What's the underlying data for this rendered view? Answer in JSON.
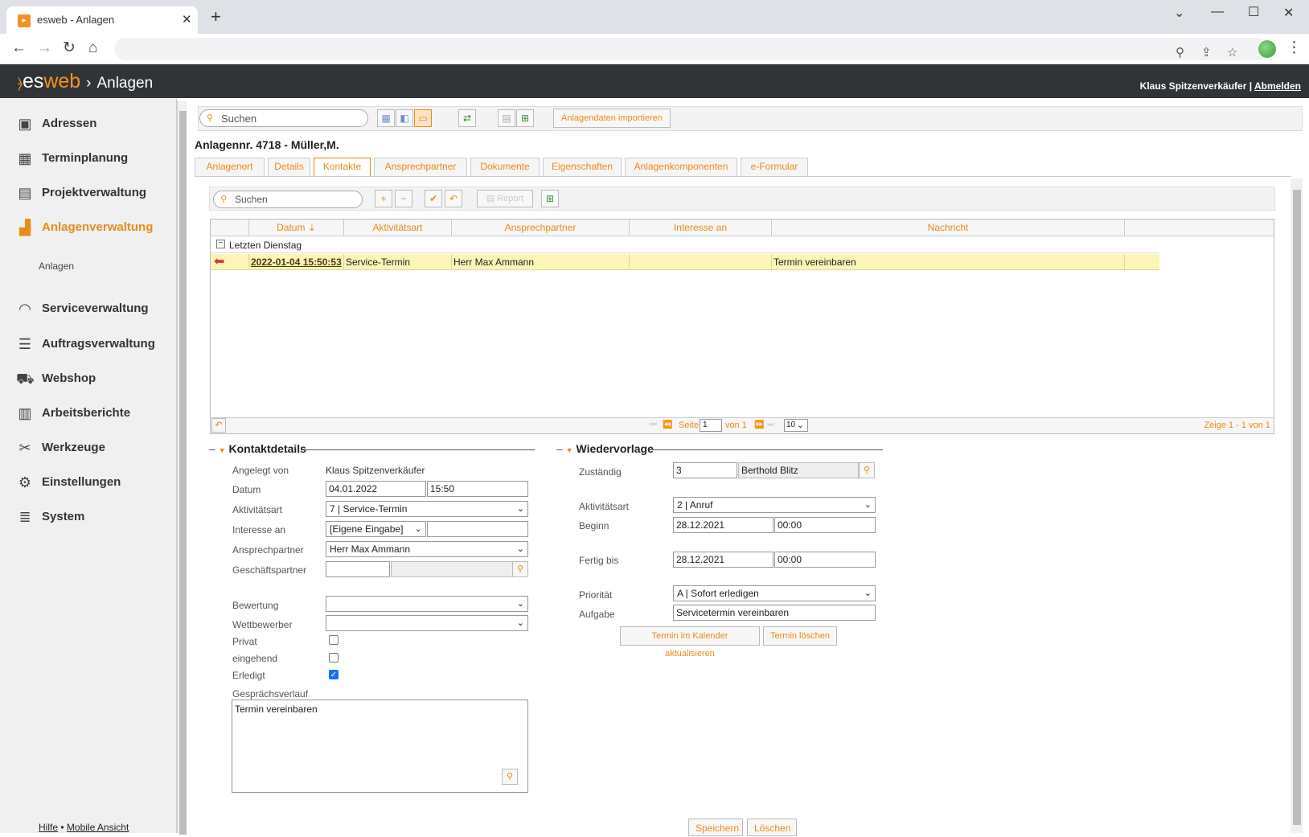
{
  "browser": {
    "tab_title": "esweb - Anlagen"
  },
  "app": {
    "logo_es": "es",
    "logo_web": "web",
    "section": "Anlagen",
    "user": "Klaus Spitzenverkäufer",
    "separator": "|",
    "logout": "Abmelden"
  },
  "sidebar": {
    "items": [
      {
        "label": "Adressen",
        "icon": "address-book-icon"
      },
      {
        "label": "Terminplanung",
        "icon": "calendar-icon"
      },
      {
        "label": "Projektverwaltung",
        "icon": "project-icon"
      },
      {
        "label": "Anlagenverwaltung",
        "icon": "factory-icon"
      },
      {
        "label": "Serviceverwaltung",
        "icon": "headset-icon"
      },
      {
        "label": "Auftragsverwaltung",
        "icon": "list-icon"
      },
      {
        "label": "Webshop",
        "icon": "cart-icon"
      },
      {
        "label": "Arbeitsberichte",
        "icon": "clipboard-icon"
      },
      {
        "label": "Werkzeuge",
        "icon": "tools-icon"
      },
      {
        "label": "Einstellungen",
        "icon": "gears-icon"
      },
      {
        "label": "System",
        "icon": "database-icon"
      }
    ],
    "sub_item": "Anlagen",
    "footer_help": "Hilfe",
    "footer_dot": "•",
    "footer_mobile": "Mobile Ansicht"
  },
  "toolbar": {
    "search_placeholder": "Suchen",
    "import_label": "Anlagendaten importieren"
  },
  "page_title": "Anlagennr. 4718 - Müller,M.",
  "tabs": [
    "Anlagenort",
    "Details",
    "Kontakte",
    "Ansprechpartner",
    "Dokumente",
    "Eigenschaften",
    "Anlagenkomponenten",
    "e-Formular"
  ],
  "grid_toolbar": {
    "search_placeholder": "Suchen",
    "report_label": "Report"
  },
  "grid": {
    "columns": [
      "Datum",
      "Aktivitätsart",
      "Ansprechpartner",
      "Interesse an",
      "Nachricht"
    ],
    "group_label": "Letzten Dienstag",
    "rows": [
      {
        "datum": "2022-01-04 15:50:53",
        "aktivitaetsart": "Service-Termin",
        "ansprechpartner": "Herr Max Ammann",
        "interesse": "",
        "nachricht": "Termin vereinbaren"
      }
    ],
    "pager": {
      "page_label": "Seite",
      "page_value": "1",
      "of_label": "von 1",
      "page_size": "10",
      "summary": "Zeige 1 - 1 von 1"
    }
  },
  "kontaktdetails": {
    "title": "Kontaktdetails",
    "angelegt_von_label": "Angelegt von",
    "angelegt_von": "Klaus Spitzenverkäufer",
    "datum_label": "Datum",
    "datum": "04.01.2022",
    "zeit": "15:50",
    "aktivitaetsart_label": "Aktivitätsart",
    "aktivitaetsart": "7 | Service-Termin",
    "interesse_label": "Interesse an",
    "interesse": "[Eigene Eingabe]",
    "ansprechpartner_label": "Ansprechpartner",
    "ansprechpartner": "Herr Max Ammann",
    "geschaeftspartner_label": "Geschäftspartner",
    "bewertung_label": "Bewertung",
    "wettbewerber_label": "Wettbewerber",
    "privat_label": "Privat",
    "eingehend_label": "eingehend",
    "erledigt_label": "Erledigt",
    "verlauf_label": "Gesprächsverlauf",
    "verlauf": "Termin vereinbaren"
  },
  "wiedervorlage": {
    "title": "Wiedervorlage",
    "zustaendig_label": "Zuständig",
    "zustaendig_nr": "3",
    "zustaendig_name": "Berthold Blitz",
    "aktivitaetsart_label": "Aktivitätsart",
    "aktivitaetsart": "2 | Anruf",
    "beginn_label": "Beginn",
    "beginn_datum": "28.12.2021",
    "beginn_zeit": "00:00",
    "fertig_label": "Fertig bis",
    "fertig_datum": "28.12.2021",
    "fertig_zeit": "00:00",
    "prioritaet_label": "Priorität",
    "prioritaet": "A | Sofort erledigen",
    "aufgabe_label": "Aufgabe",
    "aufgabe": "Servicetermin vereinbaren",
    "btn_kalender": "Termin im Kalender aktualisieren",
    "btn_loeschen": "Termin löschen"
  },
  "actions": {
    "save": "Speichern",
    "delete": "Löschen"
  },
  "colors": {
    "accent": "#e98b1b",
    "header_bg": "#303436",
    "row_highlight": "#fbf5b8"
  }
}
